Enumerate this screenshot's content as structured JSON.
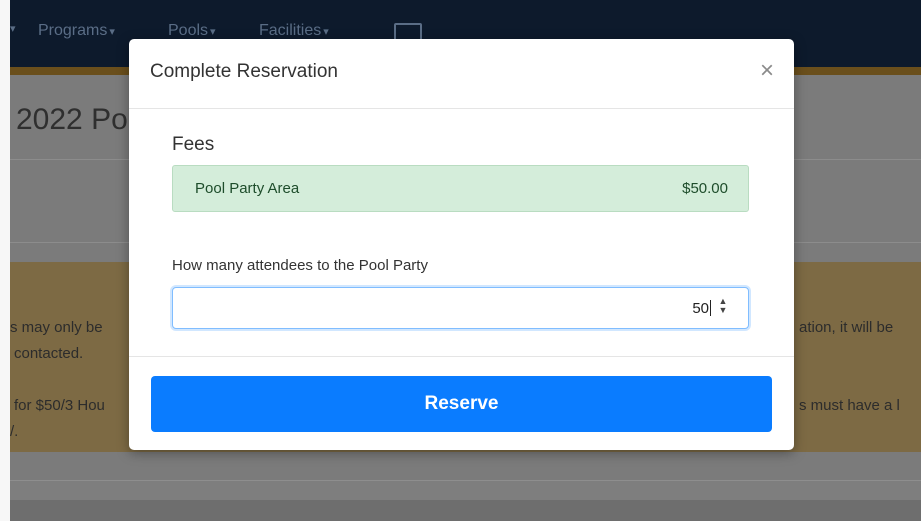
{
  "background": {
    "nav": {
      "items": [
        {
          "label": "Programs",
          "caret": "▾"
        },
        {
          "label": "Pools",
          "caret": "▾"
        },
        {
          "label": "Facilities",
          "caret": "▾"
        }
      ],
      "left_caret": "▾",
      "card_icon": "id-card-icon"
    },
    "page_title": "2022 Po",
    "notice_lines": {
      "left_1": "s may only be",
      "left_2": "contacted.",
      "left_3": "for $50/3 Hou",
      "left_4": "/.",
      "right_1": "ation, it will be",
      "right_2": "s must have a l"
    }
  },
  "modal": {
    "title": "Complete Reservation",
    "close_label": "×",
    "fees_label": "Fees",
    "fees": [
      {
        "name": "Pool Party Area",
        "amount": "$50.00"
      }
    ],
    "attendees_label": "How many attendees to the Pool Party",
    "attendees_value": "50",
    "spinner_up": "▲",
    "spinner_down": "▼",
    "reserve_label": "Reserve"
  },
  "colors": {
    "primary": "#0a7cff",
    "fee_bg": "#d4edda",
    "navbar": "#0d1a2c",
    "overlay": "#7b7b7b"
  }
}
